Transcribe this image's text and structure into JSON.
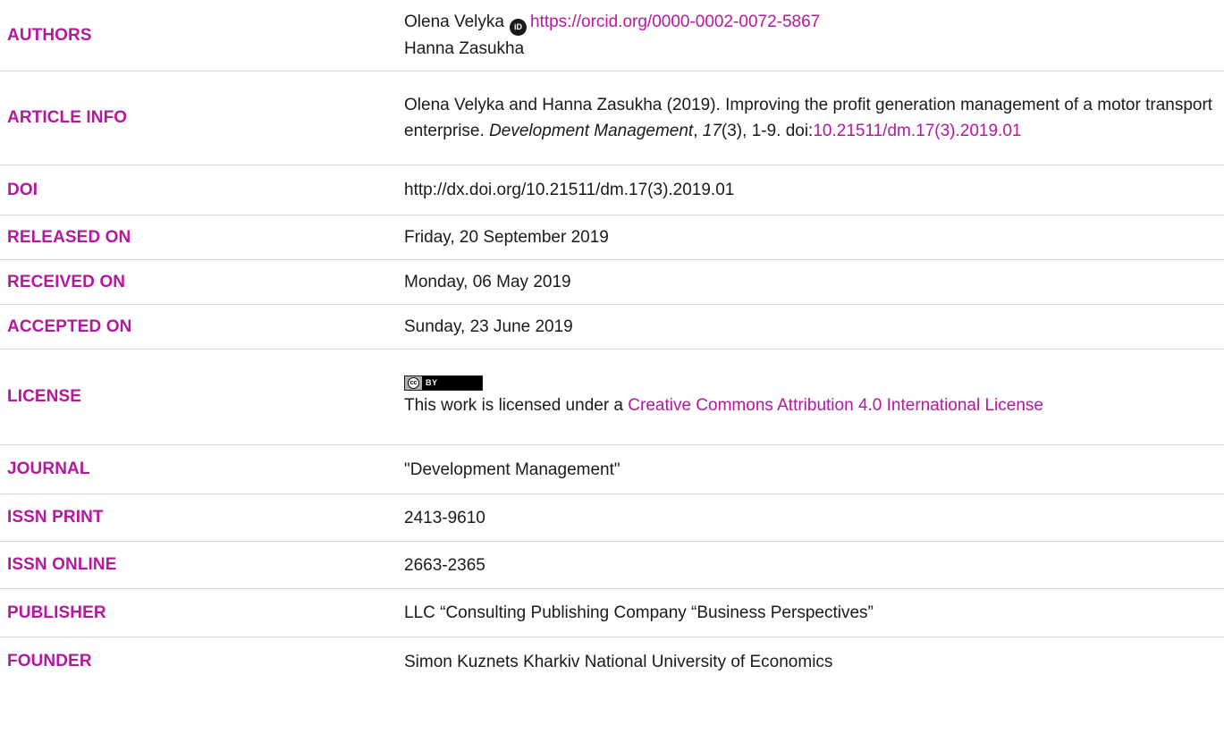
{
  "rows": {
    "authors": {
      "label": "AUTHORS",
      "author1_name": "Olena Velyka",
      "author1_orcid_url": "https://orcid.org/0000-0002-0072-5867",
      "author2_name": "Hanna Zasukha"
    },
    "article_info": {
      "label": "ARTICLE INFO",
      "citation_part1": "Olena Velyka and Hanna Zasukha (2019). Improving the profit generation management of a motor transport enterprise.",
      "journal_italic": "Development Management",
      "comma1": ",",
      "volume_italic": "17",
      "issue": "(3),",
      "pages": "1-9. doi:",
      "doi_link": "10.21511/dm.17(3).2019.01"
    },
    "doi": {
      "label": "DOI",
      "value": "http://dx.doi.org/10.21511/dm.17(3).2019.01"
    },
    "released_on": {
      "label": "RELEASED ON",
      "value": "Friday, 20 September 2019"
    },
    "received_on": {
      "label": "RECEIVED ON",
      "value": "Monday, 06 May 2019"
    },
    "accepted_on": {
      "label": "ACCEPTED ON",
      "value": "Sunday, 23 June 2019"
    },
    "license": {
      "label": "LICENSE",
      "badge_cc": "cc",
      "badge_by": "BY",
      "text_prefix": "This work is licensed under a",
      "link_text": "Creative Commons Attribution 4.0 International License"
    },
    "journal": {
      "label": "JOURNAL",
      "value": "\"Development Management\""
    },
    "issn_print": {
      "label": "ISSN PRINT",
      "value": "2413-9610"
    },
    "issn_online": {
      "label": "ISSN ONLINE",
      "value": "2663-2365"
    },
    "publisher": {
      "label": "PUBLISHER",
      "value": "LLC “Consulting Publishing Company “Business Perspectives”"
    },
    "founder": {
      "label": "FOUNDER",
      "value": "Simon Kuznets Kharkiv National University of Economics"
    }
  },
  "colors": {
    "accent": "#b5179e",
    "text": "#1a1a1a",
    "divider": "#d9d9d9"
  },
  "icons": {
    "orcid": "orcid-icon",
    "license_badge": "cc-by-badge"
  }
}
